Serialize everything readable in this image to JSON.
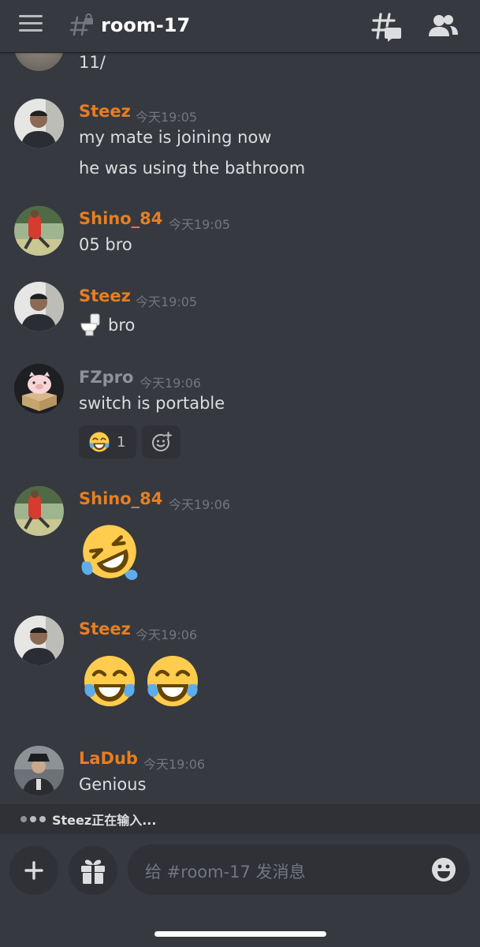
{
  "header": {
    "channel_name": "room-17"
  },
  "messages": [
    {
      "text": "11/"
    },
    {
      "username": "Steez",
      "timestamp": "今天19:05",
      "lines": [
        "my mate is joining now",
        "he was using the bathroom"
      ]
    },
    {
      "username": "Shino_84",
      "timestamp": "今天19:05",
      "lines": [
        "05 bro"
      ]
    },
    {
      "username": "Steez",
      "timestamp": "今天19:05",
      "lines": [
        "bro"
      ],
      "emoji": "toilet"
    },
    {
      "username": "FZpro",
      "timestamp": "今天19:06",
      "lines": [
        "switch is portable"
      ],
      "reactions": [
        {
          "emoji": "face-with-tears-of-joy",
          "count": "1"
        }
      ]
    },
    {
      "username": "Shino_84",
      "timestamp": "今天19:06",
      "emoji": "rolling-on-floor-laughing"
    },
    {
      "username": "Steez",
      "timestamp": "今天19:06",
      "emoji": "face-with-tears-of-joy x2"
    },
    {
      "username": "LaDub",
      "timestamp": "今天19:06",
      "lines": [
        "Genious"
      ]
    }
  ],
  "typing": {
    "user": "Steez",
    "text": "Steez正在输入..."
  },
  "composer": {
    "placeholder": "给 #room-17 发消息"
  },
  "colors": {
    "background": "#36393f",
    "username_accent": "#e67e22",
    "username_grey": "#8e9297",
    "text": "#dcddde",
    "muted": "#72767d",
    "panel": "#2f3136"
  },
  "icons": [
    "menu-icon",
    "locked-channel-icon",
    "threads-icon",
    "members-icon",
    "add-reaction-icon",
    "plus-icon",
    "gift-icon",
    "emoji-icon"
  ]
}
